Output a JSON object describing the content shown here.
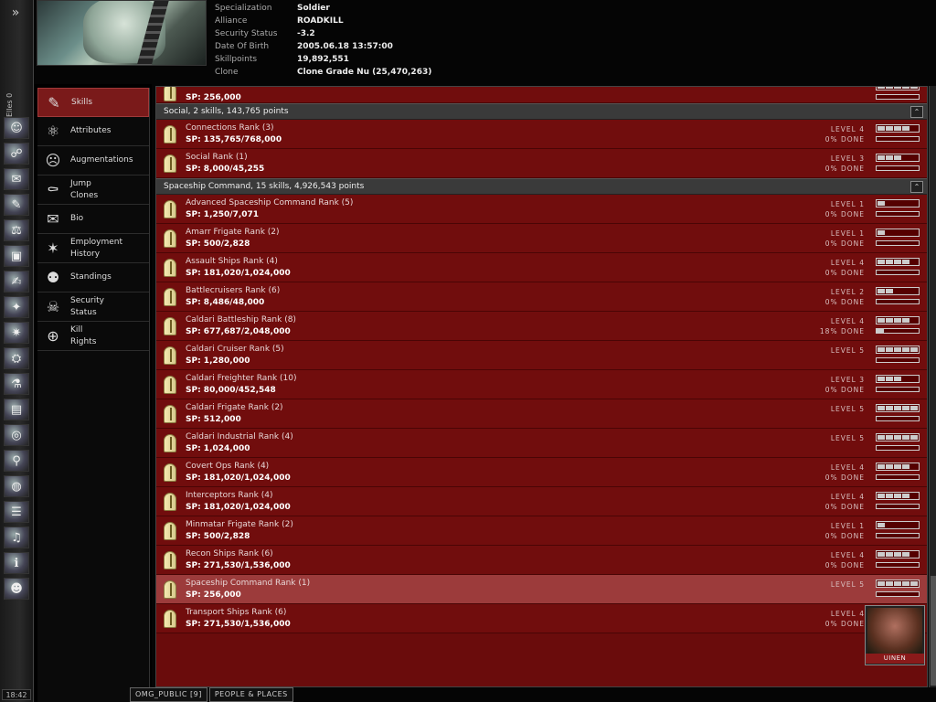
{
  "neocom": {
    "user_label": "Elles 0",
    "clock": "18:42",
    "icons": [
      "character-sheet",
      "people-places",
      "mail",
      "notepad",
      "market",
      "assets",
      "journal",
      "map",
      "corporation",
      "ship-hangar",
      "science",
      "wallet",
      "help",
      "agents",
      "browser",
      "logs",
      "music",
      "info",
      "portrait-2"
    ]
  },
  "header": {
    "rows": [
      {
        "label": "Specialization",
        "value": "Soldier"
      },
      {
        "label": "Alliance",
        "value": "ROADKILL"
      },
      {
        "label": "Security Status",
        "value": "-3.2"
      },
      {
        "label": "Date Of Birth",
        "value": "2005.06.18 13:57:00"
      },
      {
        "label": "Skillpoints",
        "value": "19,892,551"
      },
      {
        "label": "Clone",
        "value": "Clone Grade Nu (25,470,263)"
      }
    ]
  },
  "nav": [
    {
      "label": "Skills",
      "icon": "skills",
      "active": true
    },
    {
      "label": "Attributes",
      "icon": "attributes"
    },
    {
      "label": "Augmentations",
      "icon": "augmentations"
    },
    {
      "label": "Jump\nClones",
      "icon": "jump-clones"
    },
    {
      "label": "Bio",
      "icon": "bio"
    },
    {
      "label": "Employment\nHistory",
      "icon": "employment-history"
    },
    {
      "label": "Standings",
      "icon": "standings"
    },
    {
      "label": "Security\nStatus",
      "icon": "security-status"
    },
    {
      "label": "Kill\nRights",
      "icon": "kill-rights"
    }
  ],
  "skills": {
    "partial_top": {
      "sp": "SP: 256,000",
      "level": 5
    },
    "groups": [
      {
        "title": "Social, 2 skills, 143,765 points",
        "items": [
          {
            "name": "Connections Rank (3)",
            "sp": "SP: 135,765/768,000",
            "level_text": "LEVEL 4",
            "done_text": "0% DONE",
            "level": 4,
            "progress": 0
          },
          {
            "name": "Social Rank (1)",
            "sp": "SP: 8,000/45,255",
            "level_text": "LEVEL 3",
            "done_text": "0% DONE",
            "level": 3,
            "progress": 0
          }
        ]
      },
      {
        "title": "Spaceship Command, 15 skills, 4,926,543 points",
        "items": [
          {
            "name": "Advanced Spaceship Command Rank (5)",
            "sp": "SP: 1,250/7,071",
            "level_text": "LEVEL 1",
            "done_text": "0% DONE",
            "level": 1,
            "progress": 0
          },
          {
            "name": "Amarr Frigate Rank (2)",
            "sp": "SP: 500/2,828",
            "level_text": "LEVEL 1",
            "done_text": "0% DONE",
            "level": 1,
            "progress": 0
          },
          {
            "name": "Assault Ships Rank (4)",
            "sp": "SP: 181,020/1,024,000",
            "level_text": "LEVEL 4",
            "done_text": "0% DONE",
            "level": 4,
            "progress": 0
          },
          {
            "name": "Battlecruisers Rank (6)",
            "sp": "SP: 8,486/48,000",
            "level_text": "LEVEL 2",
            "done_text": "0% DONE",
            "level": 2,
            "progress": 0
          },
          {
            "name": "Caldari Battleship Rank (8)",
            "sp": "SP: 677,687/2,048,000",
            "level_text": "LEVEL 4",
            "done_text": "18% DONE",
            "level": 4,
            "progress": 18
          },
          {
            "name": "Caldari Cruiser Rank (5)",
            "sp": "SP: 1,280,000",
            "level_text": "LEVEL 5",
            "done_text": "",
            "level": 5,
            "progress": 0
          },
          {
            "name": "Caldari Freighter Rank (10)",
            "sp": "SP: 80,000/452,548",
            "level_text": "LEVEL 3",
            "done_text": "0% DONE",
            "level": 3,
            "progress": 0
          },
          {
            "name": "Caldari Frigate Rank (2)",
            "sp": "SP: 512,000",
            "level_text": "LEVEL 5",
            "done_text": "",
            "level": 5,
            "progress": 0
          },
          {
            "name": "Caldari Industrial Rank (4)",
            "sp": "SP: 1,024,000",
            "level_text": "LEVEL 5",
            "done_text": "",
            "level": 5,
            "progress": 0
          },
          {
            "name": "Covert Ops Rank (4)",
            "sp": "SP: 181,020/1,024,000",
            "level_text": "LEVEL 4",
            "done_text": "0% DONE",
            "level": 4,
            "progress": 0
          },
          {
            "name": "Interceptors Rank (4)",
            "sp": "SP: 181,020/1,024,000",
            "level_text": "LEVEL 4",
            "done_text": "0% DONE",
            "level": 4,
            "progress": 0
          },
          {
            "name": "Minmatar Frigate Rank (2)",
            "sp": "SP: 500/2,828",
            "level_text": "LEVEL 1",
            "done_text": "0% DONE",
            "level": 1,
            "progress": 0
          },
          {
            "name": "Recon Ships Rank (6)",
            "sp": "SP: 271,530/1,536,000",
            "level_text": "LEVEL 4",
            "done_text": "0% DONE",
            "level": 4,
            "progress": 0
          },
          {
            "name": "Spaceship Command Rank (1)",
            "sp": "SP: 256,000",
            "level_text": "LEVEL 5",
            "done_text": "",
            "level": 5,
            "progress": 0,
            "highlight": true
          },
          {
            "name": "Transport Ships Rank (6)",
            "sp": "SP: 271,530/1,536,000",
            "level_text": "LEVEL 4",
            "done_text": "0% DONE",
            "level": 4,
            "progress": 0
          }
        ]
      }
    ]
  },
  "chat_tabs": [
    "OMG_PUBLIC [9]",
    "PEOPLE & PLACES"
  ],
  "agent": {
    "name": "UINEN"
  }
}
